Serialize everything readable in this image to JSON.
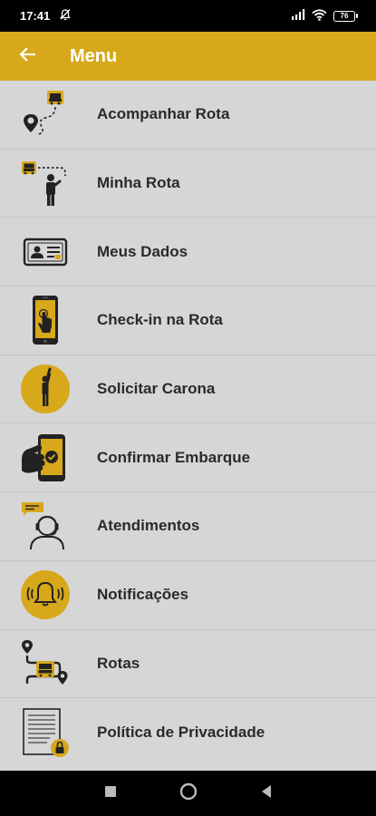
{
  "status_bar": {
    "time": "17:41",
    "battery": "76",
    "icons": [
      "mute-icon",
      "signal-icon",
      "wifi-icon",
      "battery-icon"
    ]
  },
  "app_bar": {
    "title": "Menu",
    "back_icon": "arrow-left-icon"
  },
  "menu": {
    "items": [
      {
        "label": "Acompanhar Rota",
        "icon": "bus-route-pin-icon"
      },
      {
        "label": "Minha Rota",
        "icon": "bus-person-icon"
      },
      {
        "label": "Meus Dados",
        "icon": "id-card-icon"
      },
      {
        "label": "Check-in na Rota",
        "icon": "phone-tap-icon"
      },
      {
        "label": "Solicitar Carona",
        "icon": "raise-hand-person-icon"
      },
      {
        "label": "Confirmar Embarque",
        "icon": "hand-phone-check-icon"
      },
      {
        "label": "Atendimentos",
        "icon": "support-agent-icon"
      },
      {
        "label": "Notificações",
        "icon": "bell-ringing-icon"
      },
      {
        "label": "Rotas",
        "icon": "routes-map-icon"
      },
      {
        "label": "Política de Privacidade",
        "icon": "document-lock-icon"
      }
    ]
  },
  "colors": {
    "accent": "#d7a81a",
    "background": "#d6d6d6",
    "text": "#2a2a2a",
    "divider": "#c4c4c4"
  },
  "nav_bar": {
    "icons": [
      "recents-square-icon",
      "home-circle-icon",
      "back-triangle-icon"
    ]
  }
}
